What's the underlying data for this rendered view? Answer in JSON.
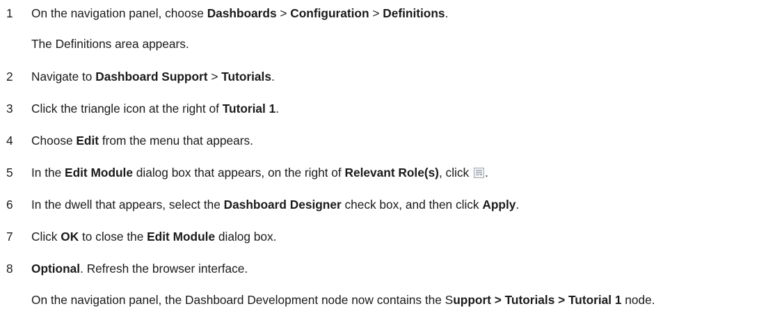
{
  "steps": [
    {
      "number": "1",
      "parts": [
        "On the navigation panel, choose ",
        "Dashboards",
        " > ",
        "Configuration",
        " > ",
        "Definitions",
        "."
      ],
      "after": "The Definitions area appears."
    },
    {
      "number": "2",
      "parts": [
        "Navigate to ",
        "Dashboard Support",
        " > ",
        "Tutorials",
        "."
      ]
    },
    {
      "number": "3",
      "parts": [
        "Click the triangle icon at the right of ",
        "Tutorial 1",
        "."
      ]
    },
    {
      "number": "4",
      "parts": [
        "Choose ",
        "Edit",
        " from the menu that appears."
      ]
    },
    {
      "number": "5",
      "parts": [
        "In the ",
        "Edit Module",
        " dialog box that appears, on the right of ",
        "Relevant Role(s)",
        ", click ",
        "."
      ],
      "icon": "list-picker-icon"
    },
    {
      "number": "6",
      "parts": [
        "In the dwell that appears, select the ",
        "Dashboard Designer",
        " check box, and then click ",
        "Apply",
        "."
      ]
    },
    {
      "number": "7",
      "parts": [
        "Click ",
        "OK",
        " to close the ",
        "Edit Module",
        " dialog box."
      ]
    },
    {
      "number": "8",
      "parts": [
        "Optional",
        ". Refresh the browser interface."
      ],
      "after_parts": [
        "On the navigation panel, the Dashboard Development node now contains the S",
        "upport > Tutorials > Tutorial 1",
        " node."
      ]
    }
  ]
}
